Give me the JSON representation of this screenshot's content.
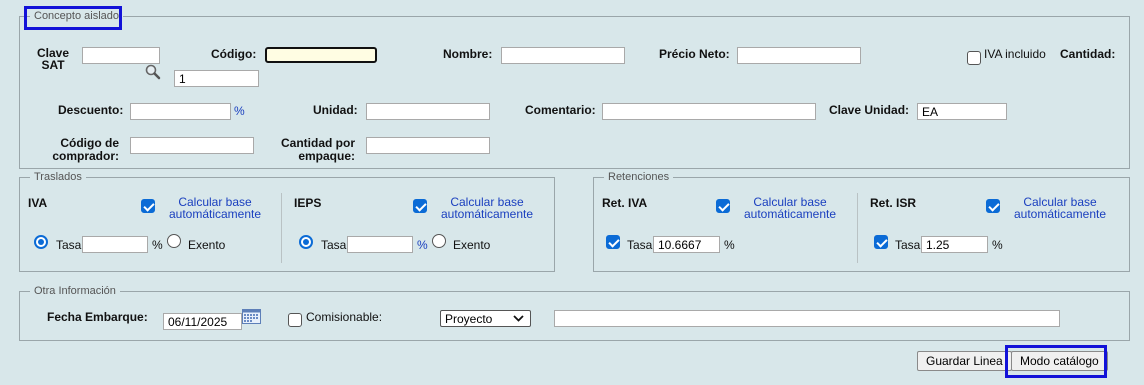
{
  "concepto": {
    "legend": "Concepto aislado",
    "clave_sat_label": "Clave\nSAT",
    "clave_sat_value": "",
    "codigo_label": "Código:",
    "codigo_value": "",
    "cantidad_small_value": "1",
    "nombre_label": "Nombre:",
    "nombre_value": "",
    "precio_label": "Précio Neto:",
    "precio_value": "",
    "iva_incluido_label": "IVA incluido",
    "cantidad_label": "Cantidad:",
    "descuento_label": "Descuento:",
    "descuento_value": "",
    "descuento_unit": "%",
    "unidad_label": "Unidad:",
    "unidad_value": "",
    "comentario_label": "Comentario:",
    "comentario_value": "",
    "clave_unidad_label": "Clave Unidad:",
    "clave_unidad_value": "EA",
    "codigo_comprador_label": "Código de\ncomprador:",
    "codigo_comprador_value": "",
    "cantidad_empaque_label": "Cantidad por\nempaque:",
    "cantidad_empaque_value": ""
  },
  "traslados": {
    "legend": "Traslados",
    "iva": {
      "title": "IVA",
      "calc_label": "Calcular base\nautomáticamente",
      "tasa_label": "Tasa",
      "tasa_value": "",
      "unit": "%",
      "exento_label": "Exento"
    },
    "ieps": {
      "title": "IEPS",
      "calc_label": "Calcular base\nautomáticamente",
      "tasa_label": "Tasa",
      "tasa_value": "",
      "unit": "%",
      "exento_label": "Exento"
    }
  },
  "retenciones": {
    "legend": "Retenciones",
    "ret_iva": {
      "title": "Ret. IVA",
      "calc_label": "Calcular base\nautomáticamente",
      "tasa_label": "Tasa",
      "tasa_value": "10.6667",
      "unit": "%"
    },
    "ret_isr": {
      "title": "Ret. ISR",
      "calc_label": "Calcular base\nautomáticamente",
      "tasa_label": "Tasa",
      "tasa_value": "1.25",
      "unit": "%"
    }
  },
  "otra": {
    "legend": "Otra Información",
    "fecha_label": "Fecha Embarque:",
    "fecha_value": "06/11/2025",
    "comisionable_label": "Comisionable:",
    "proyecto_value": "Proyecto",
    "extra_value": ""
  },
  "buttons": {
    "guardar": "Guardar Linea",
    "modo": "Modo catálogo"
  },
  "colors": {
    "background": "#d8e7ea",
    "link": "#1a3fbf",
    "check": "#0b6bd6",
    "focus": "#1212d8"
  },
  "icons": [
    "magnifier-icon",
    "calendar-icon",
    "chevron-down-icon"
  ]
}
